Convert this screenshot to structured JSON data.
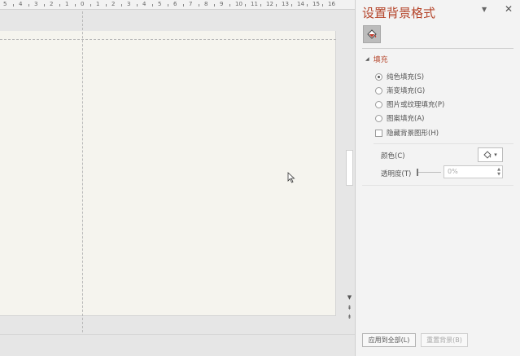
{
  "ruler": {
    "labels": [
      "5",
      "4",
      "3",
      "2",
      "1",
      "0",
      "1",
      "2",
      "3",
      "4",
      "5",
      "6",
      "7",
      "8",
      "9",
      "10",
      "11",
      "12",
      "13",
      "14",
      "15",
      "16"
    ]
  },
  "pane": {
    "title": "设置背景格式",
    "menu_glyph": "▼",
    "close_glyph": "✕",
    "fill_tab_icon": "paint-bucket-icon",
    "section": {
      "collapse_glyph": "◢",
      "label": "填充"
    },
    "fill_options": [
      {
        "label": "纯色填充(S)",
        "selected": true
      },
      {
        "label": "渐变填充(G)",
        "selected": false
      },
      {
        "label": "图片或纹理填充(P)",
        "selected": false
      },
      {
        "label": "图案填充(A)",
        "selected": false
      }
    ],
    "hide_graphics": {
      "label": "隐藏背景图形(H)",
      "checked": false
    },
    "color": {
      "label": "颜色(C)",
      "dropdown_glyph": "▾"
    },
    "transparency": {
      "label": "透明度(T)",
      "value": "0%",
      "level": 0
    },
    "buttons": {
      "apply_all": "应用到全部(L)",
      "reset_background": "重置背景(B)"
    }
  },
  "editor": {
    "scroll_glyphs": {
      "down": "▼",
      "prev_slide": "⇞",
      "next_slide": "⇟"
    }
  },
  "colors": {
    "accent": "#b5452b",
    "slide_background": "#f5f4ee",
    "pane_background": "#f3f3f3"
  }
}
